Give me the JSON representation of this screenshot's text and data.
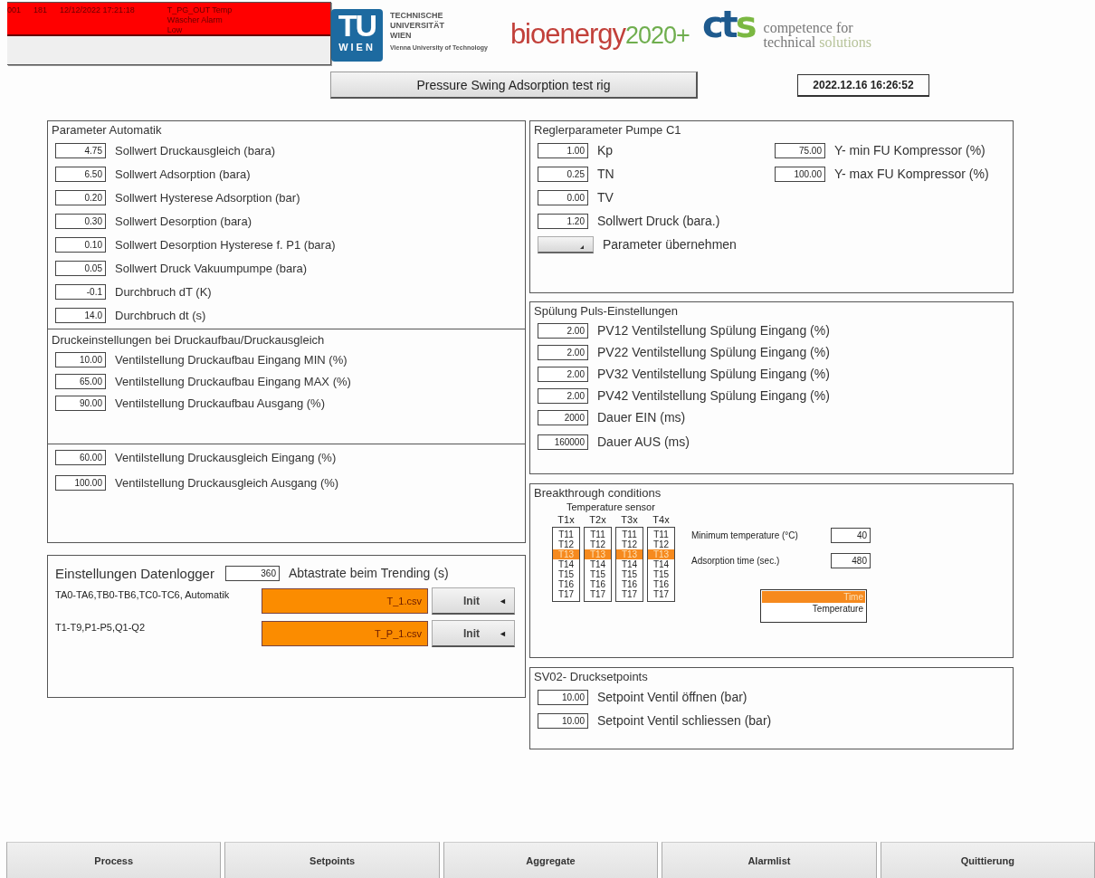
{
  "alarm": {
    "fields": [
      "001",
      "181",
      "12/12/2022 17:21:18"
    ],
    "message": "T_PG_OUT Temp Wäscher Alarm Low"
  },
  "logos": {
    "tu": {
      "mark_top": "TU",
      "mark_bottom": "WIEN",
      "lines": [
        "TECHNISCHE",
        "UNIVERSITÄT",
        "WIEN"
      ],
      "subtitle": "Vienna University of Technology"
    },
    "bioenergy": {
      "word": "bioenergy",
      "year": "2020+"
    },
    "cts": {
      "mark_a": "ct",
      "mark_b": "s",
      "line1": "competence for",
      "line2a": "technical",
      "line2b": "solutions"
    }
  },
  "title_button": "Pressure Swing Adsorption test rig",
  "datetime": "2022.12.16 16:26:52",
  "parameter_automatik": {
    "title": "Parameter Automatik",
    "rows": [
      {
        "value": "4.75",
        "label": "Sollwert Druckausgleich (bara)"
      },
      {
        "value": "6.50",
        "label": "Sollwert Adsorption (bara)"
      },
      {
        "value": "0.20",
        "label": "Sollwert Hysterese Adsorption (bar)"
      },
      {
        "value": "0.30",
        "label": "Sollwert Desorption (bara)"
      },
      {
        "value": "0.10",
        "label": "Sollwert Desorption Hysterese f. P1 (bara)"
      },
      {
        "value": "0.05",
        "label": "Sollwert Druck Vakuumpumpe (bara)"
      },
      {
        "value": "-0.1",
        "label": "Durchbruch dT (K)"
      },
      {
        "value": "14.0",
        "label": "Durchbruch dt (s)"
      }
    ]
  },
  "druckeinstellungen": {
    "title": "Druckeinstellungen bei Druckaufbau/Druckausgleich",
    "build_up_rows": [
      {
        "value": "10.00",
        "label": "Ventilstellung Druckaufbau Eingang MIN (%)"
      },
      {
        "value": "65.00",
        "label": "Ventilstellung Druckaufbau Eingang MAX (%)"
      },
      {
        "value": "90.00",
        "label": "Ventilstellung Druckaufbau Ausgang (%)"
      }
    ],
    "equalization_rows": [
      {
        "value": "60.00",
        "label": "Ventilstellung Druckausgleich Eingang (%)"
      },
      {
        "value": "100.00",
        "label": "Ventilstellung Druckausgleich Ausgang (%)"
      }
    ]
  },
  "datenlogger": {
    "title": "Einstellungen Datenlogger",
    "rate_value": "360",
    "rate_label": "Abtastrate beim Trending (s)",
    "files": [
      {
        "label": "TA0-TA6,TB0-TB6,TC0-TC6, Automatik",
        "file": "T_1.csv",
        "button": "Init",
        "arrow": "◄"
      },
      {
        "label": "T1-T9,P1-P5,Q1-Q2",
        "file": "T_P_1.csv",
        "button": "Init",
        "arrow": "◄"
      }
    ]
  },
  "regler": {
    "title": "Reglerparameter Pumpe C1",
    "left_rows": [
      {
        "value": "1.00",
        "label": "Kp"
      },
      {
        "value": "0.25",
        "label": "TN"
      },
      {
        "value": "0.00",
        "label": "TV"
      },
      {
        "value": "1.20",
        "label": "Sollwert Druck (bara.)"
      }
    ],
    "right_rows": [
      {
        "value": "75.00",
        "label": "Y- min FU Kompressor (%)"
      },
      {
        "value": "100.00",
        "label": "Y- max FU Kompressor (%)"
      }
    ],
    "apply_label": "Parameter übernehmen"
  },
  "spuelung": {
    "title": "Spülung Puls-Einstellungen",
    "rows": [
      {
        "value": "2.00",
        "label": "PV12 Ventilstellung Spülung Eingang (%)"
      },
      {
        "value": "2.00",
        "label": "PV22 Ventilstellung Spülung Eingang (%)"
      },
      {
        "value": "2.00",
        "label": "PV32 Ventilstellung Spülung Eingang (%)"
      },
      {
        "value": "2.00",
        "label": "PV42 Ventilstellung Spülung Eingang (%)"
      },
      {
        "value": "2000",
        "label": "Dauer EIN (ms)"
      },
      {
        "value": "160000",
        "label": "Dauer AUS (ms)"
      }
    ]
  },
  "breakthrough": {
    "title": "Breakthrough conditions",
    "sensor_title": "Temperature sensor",
    "sensor_lists": [
      {
        "header": "T1x",
        "items": [
          {
            "label": "T11",
            "selected": false
          },
          {
            "label": "T12",
            "selected": false
          },
          {
            "label": "T13",
            "selected": true
          },
          {
            "label": "T14",
            "selected": false
          },
          {
            "label": "T15",
            "selected": false
          },
          {
            "label": "T16",
            "selected": false
          },
          {
            "label": "T17",
            "selected": false
          }
        ]
      },
      {
        "header": "T2x",
        "items": [
          {
            "label": "T11",
            "selected": false
          },
          {
            "label": "T12",
            "selected": false
          },
          {
            "label": "T13",
            "selected": true
          },
          {
            "label": "T14",
            "selected": false
          },
          {
            "label": "T15",
            "selected": false
          },
          {
            "label": "T16",
            "selected": false
          },
          {
            "label": "T17",
            "selected": false
          }
        ]
      },
      {
        "header": "T3x",
        "items": [
          {
            "label": "T11",
            "selected": false
          },
          {
            "label": "T12",
            "selected": false
          },
          {
            "label": "T13",
            "selected": true
          },
          {
            "label": "T14",
            "selected": false
          },
          {
            "label": "T15",
            "selected": false
          },
          {
            "label": "T16",
            "selected": false
          },
          {
            "label": "T17",
            "selected": false
          }
        ]
      },
      {
        "header": "T4x",
        "items": [
          {
            "label": "T11",
            "selected": false
          },
          {
            "label": "T12",
            "selected": false
          },
          {
            "label": "T13",
            "selected": true
          },
          {
            "label": "T14",
            "selected": false
          },
          {
            "label": "T15",
            "selected": false
          },
          {
            "label": "T16",
            "selected": false
          },
          {
            "label": "T17",
            "selected": false
          }
        ]
      }
    ],
    "conditions": [
      {
        "label": "Minimum temperature (°C)",
        "value": "40"
      },
      {
        "label": "Adsorption time (sec.)",
        "value": "480"
      }
    ],
    "mode_list": [
      {
        "label": "Time",
        "selected": true
      },
      {
        "label": "Temperature",
        "selected": false
      }
    ]
  },
  "sv02": {
    "title": "SV02- Drucksetpoints",
    "rows": [
      {
        "value": "10.00",
        "label": "Setpoint Ventil öffnen (bar)"
      },
      {
        "value": "10.00",
        "label": "Setpoint Ventil schliessen (bar)"
      }
    ]
  },
  "nav_buttons": [
    "Process",
    "Setpoints",
    "Aggregate",
    "Alarmlist",
    "Quittierung"
  ]
}
